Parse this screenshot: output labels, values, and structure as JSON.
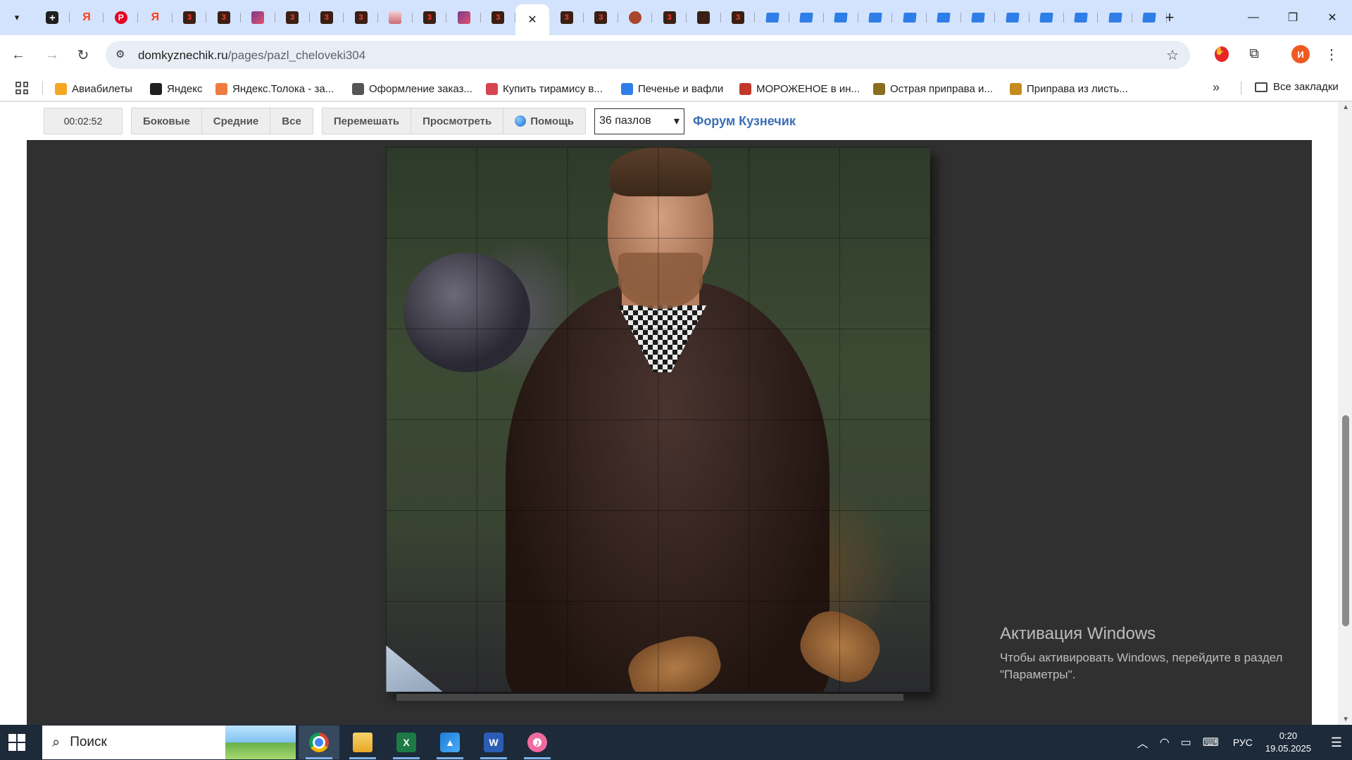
{
  "browser": {
    "tabs": [
      {
        "icon": "plus-app-icon",
        "glyph": "+",
        "style": "plus"
      },
      {
        "icon": "yandex-icon",
        "glyph": "Я",
        "style": "ya"
      },
      {
        "icon": "pinterest-icon",
        "glyph": "P",
        "style": "pin"
      },
      {
        "icon": "yandex-icon",
        "glyph": "Я",
        "style": "ya"
      },
      {
        "icon": "kuznechik-icon",
        "glyph": "3",
        "style": "z"
      },
      {
        "icon": "kuznechik-icon",
        "glyph": "3",
        "style": "z"
      },
      {
        "icon": "calendar-icon",
        "glyph": "",
        "style": "img"
      },
      {
        "icon": "kuznechik-icon",
        "glyph": "3",
        "style": "z"
      },
      {
        "icon": "kuznechik-icon",
        "glyph": "3",
        "style": "z"
      },
      {
        "icon": "kuznechik-icon",
        "glyph": "3",
        "style": "z"
      },
      {
        "icon": "cake-icon",
        "glyph": "",
        "style": "cake"
      },
      {
        "icon": "kuznechik-icon",
        "glyph": "3",
        "style": "z"
      },
      {
        "icon": "photo-icon",
        "glyph": "",
        "style": "img"
      },
      {
        "icon": "kuznechik-icon",
        "glyph": "3",
        "style": "z"
      },
      {
        "icon": "close-icon",
        "glyph": "✕",
        "style": "active"
      },
      {
        "icon": "kuznechik-icon",
        "glyph": "3",
        "style": "z"
      },
      {
        "icon": "kuznechik-icon",
        "glyph": "3",
        "style": "z"
      },
      {
        "icon": "bear-icon",
        "glyph": "",
        "style": "bear"
      },
      {
        "icon": "kuznechik-icon",
        "glyph": "3",
        "style": "z"
      },
      {
        "icon": "kuznechik-icon",
        "glyph": "",
        "style": "z"
      },
      {
        "icon": "kuznechik-icon",
        "glyph": "3",
        "style": "z"
      },
      {
        "icon": "blue-doc-icon",
        "glyph": "",
        "style": "blue"
      },
      {
        "icon": "blue-doc-icon",
        "glyph": "",
        "style": "blue"
      },
      {
        "icon": "blue-doc-icon",
        "glyph": "",
        "style": "blue"
      },
      {
        "icon": "blue-doc-icon",
        "glyph": "",
        "style": "blue"
      },
      {
        "icon": "blue-doc-icon",
        "glyph": "",
        "style": "blue"
      },
      {
        "icon": "blue-doc-icon",
        "glyph": "",
        "style": "blue"
      },
      {
        "icon": "blue-doc-icon",
        "glyph": "",
        "style": "blue"
      },
      {
        "icon": "blue-doc-icon",
        "glyph": "",
        "style": "blue"
      },
      {
        "icon": "blue-doc-icon",
        "glyph": "",
        "style": "blue"
      },
      {
        "icon": "blue-doc-icon",
        "glyph": "",
        "style": "blue"
      },
      {
        "icon": "blue-doc-icon",
        "glyph": "",
        "style": "blue"
      },
      {
        "icon": "blue-doc-icon",
        "glyph": "",
        "style": "blue"
      }
    ],
    "url_host": "domkyznechik.ru",
    "url_path": "/pages/pazl_cheloveki304",
    "profile_initial": "И",
    "bookmarks": [
      {
        "label": "Авиабилеты",
        "icon": "flight-icon",
        "color": "#f5a623"
      },
      {
        "label": "Яндекс",
        "icon": "yandex-plus-icon",
        "color": "#1f1f1f"
      },
      {
        "label": "Яндекс.Толока - за...",
        "icon": "toloka-icon",
        "color": "#f07b3f"
      },
      {
        "label": "Оформление заказ...",
        "icon": "globe-icon",
        "color": "#555555"
      },
      {
        "label": "Купить тирамису в...",
        "icon": "tiramisu-icon",
        "color": "#d64550"
      },
      {
        "label": "Печенье и вафли",
        "icon": "cookie-icon",
        "color": "#2f7ee8"
      },
      {
        "label": "МОРОЖЕНОЕ в ин...",
        "icon": "d-icon",
        "color": "#c0392b"
      },
      {
        "label": "Острая приправа и...",
        "icon": "spice-icon",
        "color": "#8a6d1f"
      },
      {
        "label": "Приправа из листь...",
        "icon": "leaf-icon",
        "color": "#c58b1e"
      }
    ],
    "all_bookmarks": "Все закладки"
  },
  "puzzle_page": {
    "timer": "00:02:52",
    "filter_buttons": [
      "Боковые",
      "Средние",
      "Все"
    ],
    "action_buttons": [
      "Перемешать",
      "Просмотреть"
    ],
    "help": "Помощь",
    "pieces_select": "36 пазлов",
    "forum_link": "Форум Кузнечик",
    "grid": {
      "columns": 6,
      "rows": 6
    }
  },
  "watermark": {
    "title": "Активация Windows",
    "line1": "Чтобы активировать Windows, перейдите в раздел",
    "line2": "\"Параметры\"."
  },
  "taskbar": {
    "search_placeholder": "Поиск",
    "apps": [
      {
        "name": "chrome",
        "active": true
      },
      {
        "name": "file-explorer",
        "active": false
      },
      {
        "name": "excel",
        "active": false
      },
      {
        "name": "photos",
        "active": false
      },
      {
        "name": "word",
        "active": false
      },
      {
        "name": "itunes",
        "active": false
      }
    ],
    "language": "РУС",
    "time": "0:20",
    "date": "19.05.2025"
  }
}
